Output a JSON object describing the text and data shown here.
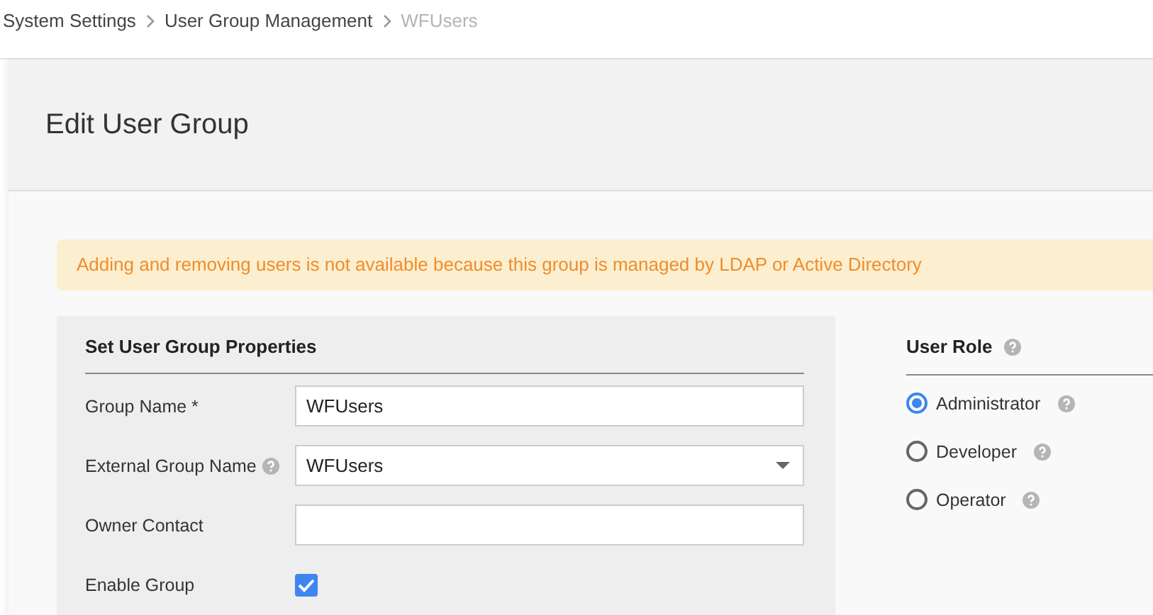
{
  "breadcrumb": [
    {
      "label": "System Settings",
      "current": false
    },
    {
      "label": "User Group Management",
      "current": false
    },
    {
      "label": "WFUsers",
      "current": true
    }
  ],
  "page_title": "Edit User Group",
  "alert": "Adding and removing users is not available because this group is managed by LDAP or Active Directory",
  "properties": {
    "title": "Set User Group Properties",
    "fields": [
      {
        "kind": "text",
        "label": "Group Name *",
        "help": false,
        "value": "WFUsers"
      },
      {
        "kind": "select",
        "label": "External Group Name",
        "help": true,
        "value": "WFUsers"
      },
      {
        "kind": "text",
        "label": "Owner Contact",
        "help": false
      },
      {
        "kind": "checkbox",
        "label": "Enable Group",
        "help": false,
        "checked": true
      }
    ]
  },
  "user_role": {
    "title": "User Role",
    "options": [
      {
        "label": "Administrator",
        "selected": true
      },
      {
        "label": "Developer",
        "selected": false
      },
      {
        "label": "Operator",
        "selected": false
      }
    ]
  }
}
